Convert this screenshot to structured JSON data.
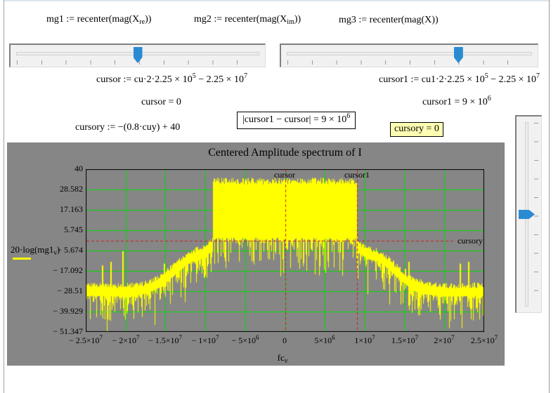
{
  "window": {
    "bg": "#ffffff",
    "panel_bg": "#868686"
  },
  "expressions": {
    "mg1": [
      {
        "t": "mg1 := recenter(mag(X"
      },
      {
        "t": "re",
        "s": "sub"
      },
      {
        "t": "))"
      }
    ],
    "mg2": [
      {
        "t": "mg2 := recenter(mag(X"
      },
      {
        "t": "im",
        "s": "sub"
      },
      {
        "t": "))"
      }
    ],
    "mg3": [
      {
        "t": "mg3 := recenter(mag(X))"
      }
    ],
    "cursor_def": [
      {
        "t": "cursor := cu·2·2.25 × 10"
      },
      {
        "t": "5",
        "s": "sup"
      },
      {
        "t": " − 2.25 × 10"
      },
      {
        "t": "7",
        "s": "sup"
      }
    ],
    "cursor_val": [
      {
        "t": "cursor = 0"
      }
    ],
    "cursor1_def": [
      {
        "t": "cursor1 := cu1·2·2.25 × 10"
      },
      {
        "t": "5",
        "s": "sup"
      },
      {
        "t": " − 2.25 × 10"
      },
      {
        "t": "7",
        "s": "sup"
      }
    ],
    "cursor1_val": [
      {
        "t": "cursor1 = 9 × 10"
      },
      {
        "t": "6",
        "s": "sup"
      }
    ],
    "cursory_def": [
      {
        "t": "cursory := −(0.8·cuy) + 40"
      }
    ],
    "diff_val": [
      {
        "t": "|cursor1 − cursor| = 9 × 10"
      },
      {
        "t": "6",
        "s": "sup"
      }
    ],
    "cursory_val": [
      {
        "t": "cursory = 0"
      }
    ]
  },
  "sliders": {
    "thumb_color": "#2a8bd3",
    "cu": {
      "percent": 50,
      "orientation": "horizontal"
    },
    "cu1": {
      "percent": 70,
      "orientation": "horizontal"
    },
    "cuy": {
      "percent": 50,
      "orientation": "vertical"
    }
  },
  "chart_data": {
    "type": "line",
    "title": "Centered Amplitude spectrum of I",
    "xlabel": "fcν",
    "ylabel": "20·log(mg1ν)",
    "xlabel_segments": [
      {
        "t": "fc"
      },
      {
        "t": "ν",
        "s": "sub"
      }
    ],
    "ylabel_segments": [
      {
        "t": "20·log(mg1"
      },
      {
        "t": "ν",
        "s": "sub"
      },
      {
        "t": ")"
      }
    ],
    "xlim": [
      -25000000,
      25000000
    ],
    "ylim": [
      -51.347,
      40
    ],
    "grid": true,
    "grid_color": "#00dd00",
    "frame_color": "#000000",
    "plot_bg": "#868686",
    "trace_color": "#ffff00",
    "marker_color": "#c52222",
    "y_ticks": [
      40,
      28.582,
      17.163,
      5.745,
      -5.674,
      -17.092,
      -28.51,
      -39.929,
      -51.347
    ],
    "y_tick_labels": [
      "40",
      "28.582",
      "17.163",
      "5.745",
      "− 5.674",
      "− 17.092",
      "− 28.51",
      "− 39.929",
      "− 51.347"
    ],
    "x_tick_values": [
      -25000000,
      -20000000,
      -15000000,
      -10000000,
      -5000000,
      0,
      5000000,
      10000000,
      15000000,
      20000000,
      25000000
    ],
    "x_tick_segments": [
      [
        {
          "t": "− 2.5×10"
        },
        {
          "t": "7",
          "s": "sup"
        }
      ],
      [
        {
          "t": "− 2×10"
        },
        {
          "t": "7",
          "s": "sup"
        }
      ],
      [
        {
          "t": "− 1.5×10"
        },
        {
          "t": "7",
          "s": "sup"
        }
      ],
      [
        {
          "t": "− 1×10"
        },
        {
          "t": "7",
          "s": "sup"
        }
      ],
      [
        {
          "t": "− 5×10"
        },
        {
          "t": "6",
          "s": "sup"
        }
      ],
      [
        {
          "t": "0"
        }
      ],
      [
        {
          "t": "5×10"
        },
        {
          "t": "6",
          "s": "sup"
        }
      ],
      [
        {
          "t": "1×10"
        },
        {
          "t": "7",
          "s": "sup"
        }
      ],
      [
        {
          "t": "1.5×10"
        },
        {
          "t": "7",
          "s": "sup"
        }
      ],
      [
        {
          "t": "2×10"
        },
        {
          "t": "7",
          "s": "sup"
        }
      ],
      [
        {
          "t": "2.5×10"
        },
        {
          "t": "7",
          "s": "sup"
        }
      ]
    ],
    "series": [
      {
        "name": "20·log(mg1ν)",
        "color": "#ffff00",
        "description": "noisy centered amplitude spectrum: flat-top band from -9 MHz to +9 MHz near 33 dB, shoulder humps decaying to a -28.5 dB noise floor"
      }
    ],
    "markers": {
      "vertical": [
        {
          "label": "cursor",
          "x": 0
        },
        {
          "label": "cursor1",
          "x": 9000000
        }
      ],
      "horizontal": [
        {
          "label": "cursory",
          "y": 0
        }
      ]
    },
    "signal": {
      "seed": 7,
      "band_edge_hz": 9000000,
      "band_top_db_min": 31.5,
      "band_top_db_max": 35.2,
      "band_base_db": 1.5,
      "band_notch_prob": 0.6,
      "band_notch_depth_db": 22,
      "floor_profile": [
        [
          9000000,
          -1.5
        ],
        [
          9600000,
          -5
        ],
        [
          10500000,
          -7.5
        ],
        [
          11500000,
          -8.5
        ],
        [
          12500000,
          -11
        ],
        [
          14000000,
          -17
        ],
        [
          15500000,
          -23
        ],
        [
          17500000,
          -27
        ],
        [
          20000000,
          -28.5
        ],
        [
          25000000,
          -28
        ]
      ],
      "floor_fuzz_top_db": 3,
      "floor_spike_depth_db": 14,
      "deep_spike_prob": 0.06,
      "deep_spike_extra_db": 21,
      "spikes": [
        {
          "f": -23000000,
          "v": -14
        },
        {
          "f": -21900000,
          "v": -12
        },
        {
          "f": -20400000,
          "v": -6
        },
        {
          "f": -15200000,
          "v": -13
        },
        {
          "f": -14600000,
          "v": -17
        },
        {
          "f": 15000000,
          "v": -16
        },
        {
          "f": 15500000,
          "v": -12
        },
        {
          "f": 21900000,
          "v": -13
        },
        {
          "f": 23000000,
          "v": -12
        }
      ]
    }
  }
}
